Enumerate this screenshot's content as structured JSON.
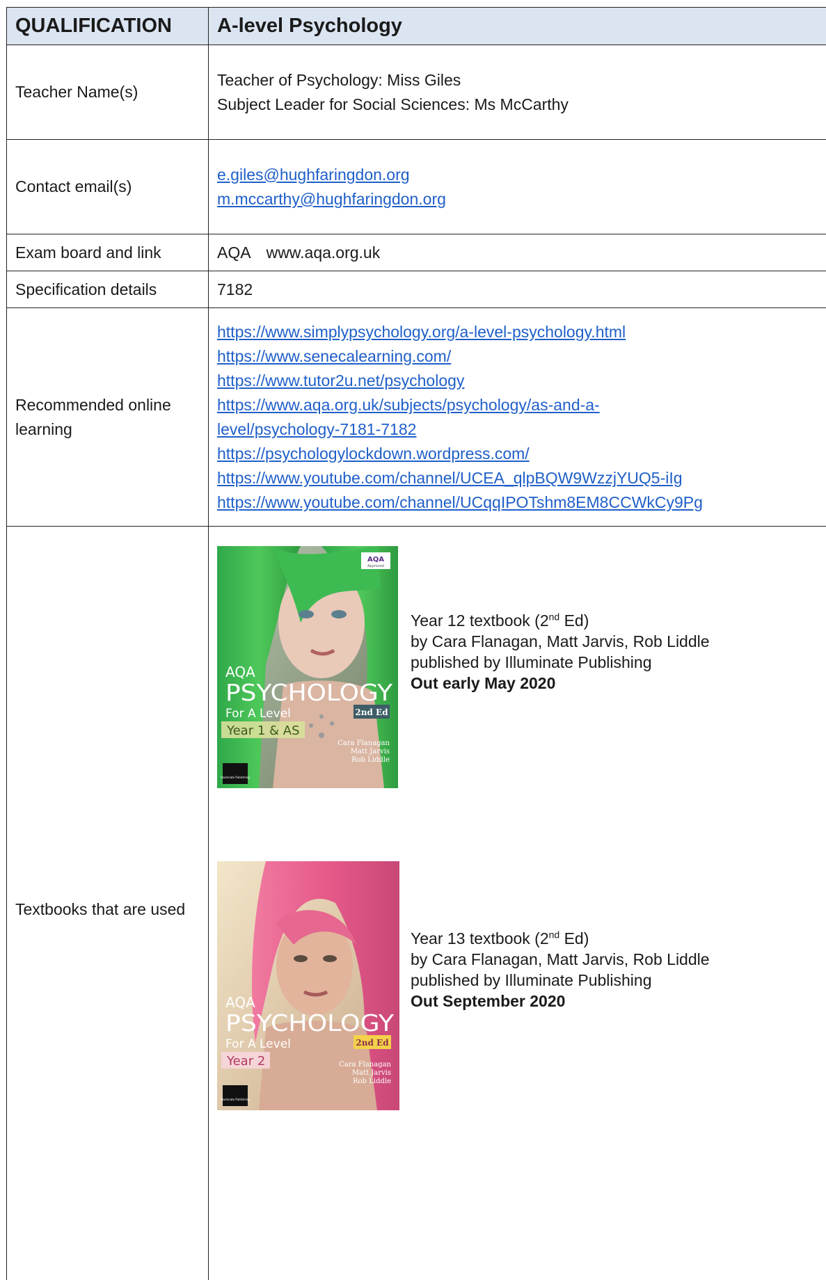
{
  "header": {
    "qualification_label": "QUALIFICATION",
    "qualification_value": "A-level Psychology"
  },
  "rows": {
    "teacher": {
      "label": "Teacher Name(s)",
      "lines": [
        "Teacher of Psychology: Miss Giles",
        "Subject Leader for Social Sciences: Ms McCarthy"
      ]
    },
    "email": {
      "label": "Contact email(s)",
      "links": [
        "e.giles@hughfaringdon.org",
        "m.mccarthy@hughfaringdon.org"
      ]
    },
    "board": {
      "label": "Exam board and link",
      "name": "AQA",
      "url": "www.aqa.org.uk"
    },
    "spec": {
      "label": "Specification details",
      "value": "7182"
    },
    "online": {
      "label": "Recommended online learning",
      "links": [
        "https://www.simplypsychology.org/a-level-psychology.html",
        "https://www.senecalearning.com/",
        "https://www.tutor2u.net/psychology",
        "https://www.aqa.org.uk/subjects/psychology/as-and-a-",
        "level/psychology-7181-7182",
        "https://psychologylockdown.wordpress.com/",
        "https://www.youtube.com/channel/UCEA_qlpBQW9WzzjYUQ5-iIg",
        "https://www.youtube.com/channel/UCqqIPOTshm8EM8CCWkCy9Pg"
      ]
    },
    "books": {
      "label": "Textbooks that are used",
      "year12": {
        "title_prefix": "Year 12 textbook (2",
        "title_sup": "nd",
        "title_suffix": " Ed)",
        "authors": "by Cara Flanagan, Matt Jarvis, Rob Liddle",
        "publisher": "published by Illuminate Publishing",
        "release": "Out early May 2020",
        "cover": {
          "badge": "AQA",
          "badge_sub": "Approved",
          "top": "AQA",
          "title": "PSYCHOLOGY",
          "edition": "2nd Ed",
          "subtitle": "For A Level",
          "year": "Year 1 & AS",
          "authors": [
            "Cara Flanagan",
            "Matt Jarvis",
            "Rob Liddle"
          ],
          "publisher": "Illuminate Publishing"
        }
      },
      "year13": {
        "title_prefix": "Year 13 textbook (2",
        "title_sup": "nd",
        "title_suffix": " Ed)",
        "authors": "by Cara Flanagan, Matt Jarvis, Rob Liddle",
        "publisher": "published by Illuminate Publishing",
        "release": "Out September 2020",
        "cover": {
          "top": "AQA",
          "title": "PSYCHOLOGY",
          "edition": "2nd Ed",
          "subtitle": "For A Level",
          "year": "Year 2",
          "authors": [
            "Cara Flanagan",
            "Matt Jarvis",
            "Rob Liddle"
          ],
          "publisher": "Illuminate Publishing"
        }
      }
    }
  },
  "colors": {
    "header_bg": "#dbe4f1",
    "link": "#1f5fc9",
    "cover1_hair": "#39b54a",
    "cover2_hair": "#ee5d8f"
  }
}
